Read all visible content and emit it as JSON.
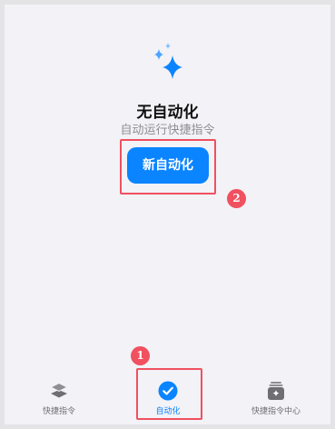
{
  "empty_state": {
    "title": "无自动化",
    "subtitle": "自动运行快捷指令",
    "icon": "sparkles-icon"
  },
  "actions": {
    "new_automation_label": "新自动化"
  },
  "annotations": {
    "marker_1": "1",
    "marker_2": "2",
    "color": "#f0505f"
  },
  "tabbar": {
    "tabs": [
      {
        "label": "快捷指令",
        "icon": "layers-icon",
        "active": false
      },
      {
        "label": "自动化",
        "icon": "clock-check-icon",
        "active": true
      },
      {
        "label": "快捷指令中心",
        "icon": "gallery-icon",
        "active": false
      }
    ]
  },
  "colors": {
    "accent": "#0a84ff",
    "background": "#f2f2f7",
    "inactive": "#6e6e73"
  }
}
